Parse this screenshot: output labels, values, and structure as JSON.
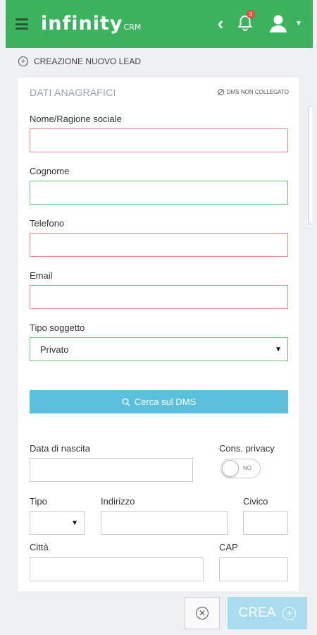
{
  "header": {
    "logo_text": "infinity",
    "logo_suffix": "CRM",
    "notifications_count": "3",
    "brand_color": "#3cb15e"
  },
  "page": {
    "section_title": "CREAZIONE NUOVO LEAD"
  },
  "card": {
    "title": "DATI ANAGRAFICI",
    "dms_status": "DMS NON COLLEGATO"
  },
  "form": {
    "nome_label": "Nome/Ragione sociale",
    "cognome_label": "Cognome",
    "telefono_label": "Telefono",
    "email_label": "Email",
    "tipo_soggetto_label": "Tipo soggetto",
    "tipo_soggetto_value": "Privato",
    "search_dms_label": "Cerca sul DMS",
    "data_nascita_label": "Data di nascita",
    "privacy_label": "Cons. privacy",
    "privacy_toggle_text": "NO",
    "tipo_label": "Tipo",
    "indirizzo_label": "Indirizzo",
    "civico_label": "Civico",
    "citta_label": "Città",
    "cap_label": "CAP"
  },
  "footer": {
    "create_label": "CREA"
  },
  "icons": [
    "hamburger-icon",
    "back-chevron-icon",
    "bell-icon",
    "user-icon",
    "add-circle-icon",
    "ban-icon",
    "search-icon",
    "close-circle-icon",
    "plus-circle-icon"
  ]
}
